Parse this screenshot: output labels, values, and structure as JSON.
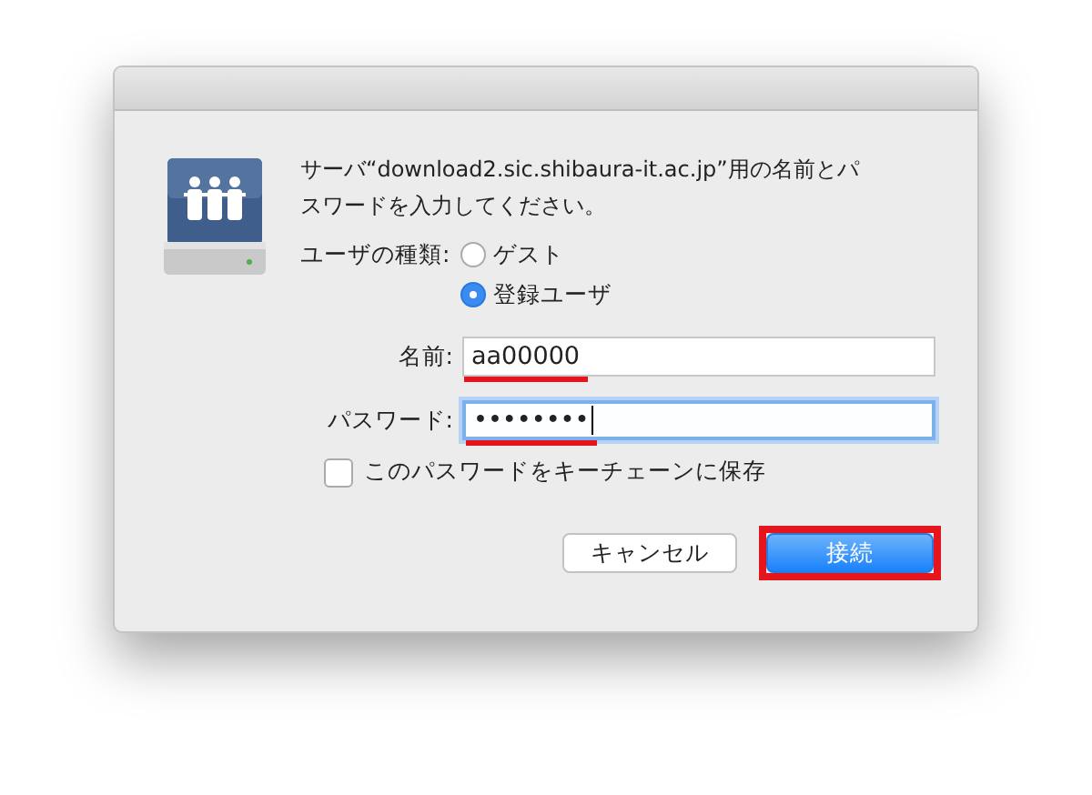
{
  "message": "サーバ“download2.sic.shibaura-it.ac.jp”用の名前とパスワードを入力してください。",
  "user_type": {
    "label": "ユーザの種類:",
    "options": [
      {
        "label": "ゲスト",
        "selected": false
      },
      {
        "label": "登録ユーザ",
        "selected": true
      }
    ]
  },
  "fields": [
    {
      "label": "名前:",
      "value": "aa00000",
      "focused": false,
      "highlighted": true
    },
    {
      "label": "パスワード:",
      "value": "••••••••",
      "focused": true,
      "highlighted": true
    }
  ],
  "keychain": {
    "label": "このパスワードをキーチェーンに保存",
    "checked": false
  },
  "buttons": [
    {
      "label": "キャンセル",
      "kind": "secondary",
      "highlighted": false
    },
    {
      "label": "接続",
      "kind": "primary",
      "highlighted": true
    }
  ]
}
